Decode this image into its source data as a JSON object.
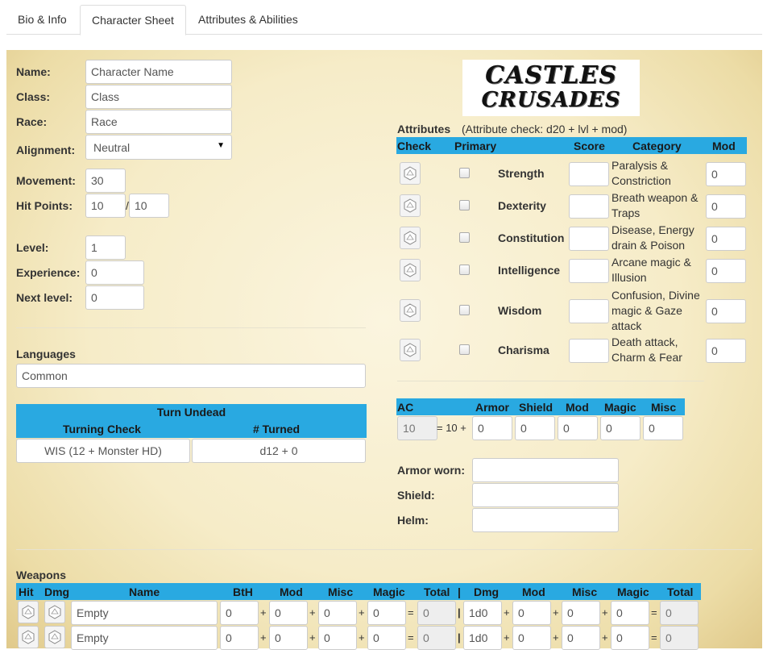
{
  "tabs": [
    "Bio & Info",
    "Character Sheet",
    "Attributes & Abilities"
  ],
  "logo": {
    "line1": "CASTLES",
    "line2": "CRUSADES",
    "alt": "Castles & Crusades logo"
  },
  "info": {
    "name_label": "Name:",
    "name_value": "Character Name",
    "class_label": "Class:",
    "class_value": "Class",
    "race_label": "Race:",
    "race_value": "Race",
    "alignment_label": "Alignment:",
    "alignment_value": "Neutral",
    "movement_label": "Movement:",
    "movement_value": "30",
    "hp_label": "Hit Points:",
    "hp_current": "10",
    "hp_sep": "/",
    "hp_max": "10",
    "level_label": "Level:",
    "level_value": "1",
    "experience_label": "Experience:",
    "experience_value": "0",
    "next_level_label": "Next level:",
    "next_level_value": "0"
  },
  "languages": {
    "label": "Languages",
    "value": "Common"
  },
  "turn_undead": {
    "title": "Turn Undead",
    "col1": "Turning Check",
    "col2": "# Turned",
    "check_value": "WIS (12 + Monster HD)",
    "turned_value": "d12 + 0"
  },
  "attributes": {
    "title": "Attributes",
    "hint": "(Attribute check: d20 + lvl + mod)",
    "headers": {
      "check": "Check",
      "primary": "Primary",
      "score": "Score",
      "category": "Category",
      "mod": "Mod"
    },
    "rows": [
      {
        "name": "Strength",
        "category": "Paralysis & Constriction",
        "score": "",
        "mod": "0"
      },
      {
        "name": "Dexterity",
        "category": "Breath weapon & Traps",
        "score": "",
        "mod": "0"
      },
      {
        "name": "Constitution",
        "category": "Disease, Energy drain & Poison",
        "score": "",
        "mod": "0"
      },
      {
        "name": "Intelligence",
        "category": "Arcane magic & Illusion",
        "score": "",
        "mod": "0"
      },
      {
        "name": "Wisdom",
        "category": "Confusion, Divine magic & Gaze attack",
        "score": "",
        "mod": "0"
      },
      {
        "name": "Charisma",
        "category": "Death attack, Charm & Fear",
        "score": "",
        "mod": "0"
      }
    ]
  },
  "armor_class": {
    "headers": {
      "ac": "AC",
      "armor": "Armor",
      "shield": "Shield",
      "mod": "Mod",
      "magic": "Magic",
      "misc": "Misc"
    },
    "ac_value": "10",
    "formula": "= 10 +",
    "armor": "0",
    "shield": "0",
    "mod": "0",
    "magic": "0",
    "misc": "0"
  },
  "gear": {
    "armor_label": "Armor worn:",
    "shield_label": "Shield:",
    "helm_label": "Helm:"
  },
  "weapons": {
    "label": "Weapons",
    "headers": [
      "Hit",
      "Dmg",
      "Name",
      "BtH",
      "Mod",
      "Misc",
      "Magic",
      "Total",
      "|",
      "Dmg",
      "Mod",
      "Misc",
      "Magic",
      "Total"
    ],
    "rows": [
      {
        "name": "Empty",
        "bth": "0",
        "mod": "0",
        "misc": "0",
        "magic": "0",
        "total": "0",
        "dmg": "1d0",
        "dmod": "0",
        "dmisc": "0",
        "dmagic": "0",
        "dtotal": "0"
      },
      {
        "name": "Empty",
        "bth": "0",
        "mod": "0",
        "misc": "0",
        "magic": "0",
        "total": "0",
        "dmg": "1d0",
        "dmod": "0",
        "dmisc": "0",
        "dmagic": "0",
        "dtotal": "0"
      }
    ],
    "plus": "+",
    "equals": "=",
    "bar": "|"
  }
}
